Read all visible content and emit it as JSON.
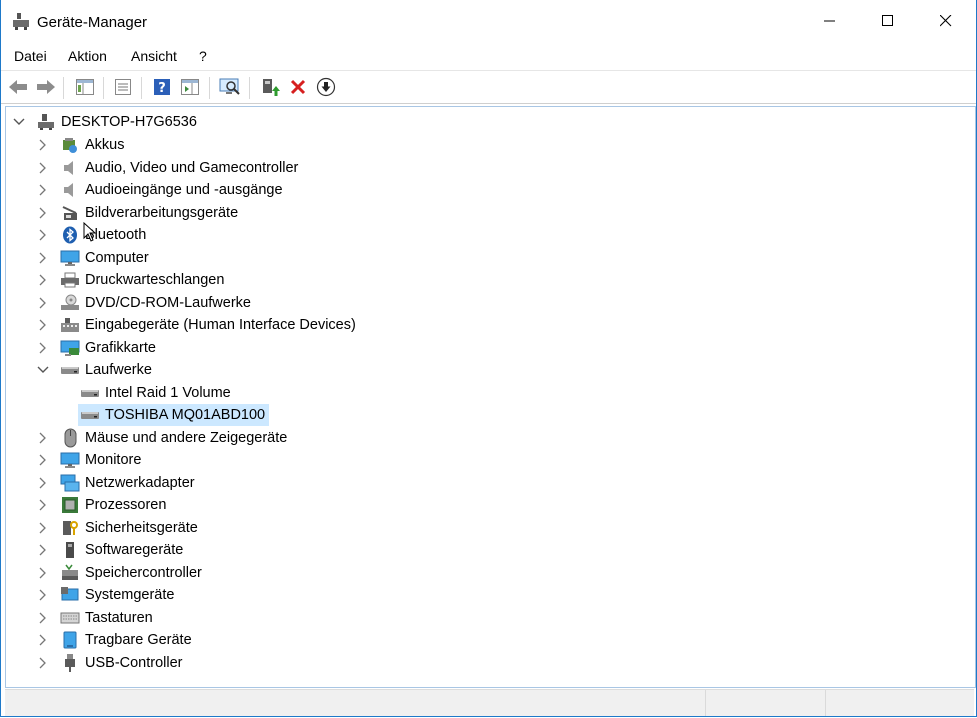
{
  "window": {
    "title": "Geräte-Manager",
    "accent": "#1e79c9",
    "controls": {
      "minimize": "minimize-icon",
      "maximize": "maximize-icon",
      "close": "close-icon"
    }
  },
  "menu": [
    "Datei",
    "Aktion",
    "Ansicht",
    "?"
  ],
  "toolbar": [
    "back-arrow-icon",
    "forward-arrow-icon",
    "show-hide-console-tree-icon",
    "properties-icon",
    "help-icon",
    "action-pane-icon",
    "scan-hardware-icon",
    "update-driver-icon",
    "uninstall-device-icon",
    "disable-device-icon"
  ],
  "tree": {
    "root": "DESKTOP-H7G6536",
    "categories": [
      {
        "label": "Akkus",
        "icon": "battery-icon"
      },
      {
        "label": "Audio, Video und Gamecontroller",
        "icon": "speaker-icon"
      },
      {
        "label": "Audioeingänge und -ausgänge",
        "icon": "speaker-icon"
      },
      {
        "label": "Bildverarbeitungsgeräte",
        "icon": "camera-icon"
      },
      {
        "label": "Bluetooth",
        "icon": "bluetooth-icon"
      },
      {
        "label": "Computer",
        "icon": "monitor-icon"
      },
      {
        "label": "Druckwarteschlangen",
        "icon": "printer-icon"
      },
      {
        "label": "DVD/CD-ROM-Laufwerke",
        "icon": "disc-drive-icon"
      },
      {
        "label": "Eingabegeräte (Human Interface Devices)",
        "icon": "hid-icon"
      },
      {
        "label": "Grafikkarte",
        "icon": "display-adapter-icon"
      },
      {
        "label": "Laufwerke",
        "icon": "disk-drive-icon",
        "expanded": true,
        "children": [
          {
            "label": "Intel Raid 1 Volume",
            "icon": "disk-drive-icon"
          },
          {
            "label": "TOSHIBA MQ01ABD100",
            "icon": "disk-drive-icon",
            "selected": true
          }
        ]
      },
      {
        "label": "Mäuse und andere Zeigegeräte",
        "icon": "mouse-icon"
      },
      {
        "label": "Monitore",
        "icon": "monitor-icon"
      },
      {
        "label": "Netzwerkadapter",
        "icon": "network-adapter-icon"
      },
      {
        "label": "Prozessoren",
        "icon": "processor-icon"
      },
      {
        "label": "Sicherheitsgeräte",
        "icon": "security-device-icon"
      },
      {
        "label": "Softwaregeräte",
        "icon": "software-device-icon"
      },
      {
        "label": "Speichercontroller",
        "icon": "storage-controller-icon"
      },
      {
        "label": "Systemgeräte",
        "icon": "system-device-icon"
      },
      {
        "label": "Tastaturen",
        "icon": "keyboard-icon"
      },
      {
        "label": "Tragbare Geräte",
        "icon": "portable-device-icon"
      },
      {
        "label": "USB-Controller",
        "icon": "usb-icon"
      }
    ]
  },
  "colors": {
    "selection": "#cce8ff",
    "tree_border": "#a9c6e4"
  }
}
